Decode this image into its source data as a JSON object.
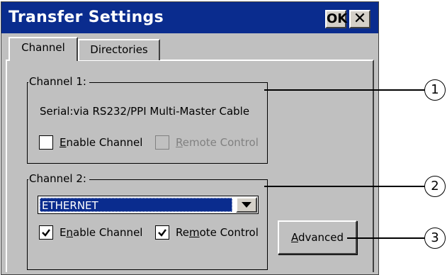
{
  "window": {
    "title": "Transfer Settings",
    "ok_label": "OK",
    "close_glyph": "✕"
  },
  "tabs": [
    {
      "label": "Channel",
      "active": true
    },
    {
      "label": "Directories",
      "active": false
    }
  ],
  "channel1": {
    "label": "Channel 1:",
    "info": "Serial:via RS232/PPI Multi-Master Cable",
    "enable": {
      "pre": "",
      "mnemonic": "E",
      "post": "nable Channel",
      "checked": false,
      "enabled": true
    },
    "remote": {
      "pre": "",
      "mnemonic": "R",
      "post": "emote Control",
      "checked": false,
      "enabled": false
    }
  },
  "channel2": {
    "label": "Channel 2:",
    "protocol": "ETHERNET",
    "enable": {
      "pre": "E",
      "mnemonic": "n",
      "post": "able Channel",
      "checked": true,
      "enabled": true
    },
    "remote": {
      "pre": "Re",
      "mnemonic": "m",
      "post": "ote Control",
      "checked": true,
      "enabled": true
    }
  },
  "advanced": {
    "mnemonic": "A",
    "post": "dvanced"
  },
  "callouts": [
    "1",
    "2",
    "3"
  ],
  "colors": {
    "titlebar": "#0a2c8e",
    "dialog_bg": "#c0c0c0",
    "selection": "#0a2c8e"
  },
  "icons": [
    "close-icon",
    "chevron-down-icon",
    "checkmark-icon"
  ]
}
